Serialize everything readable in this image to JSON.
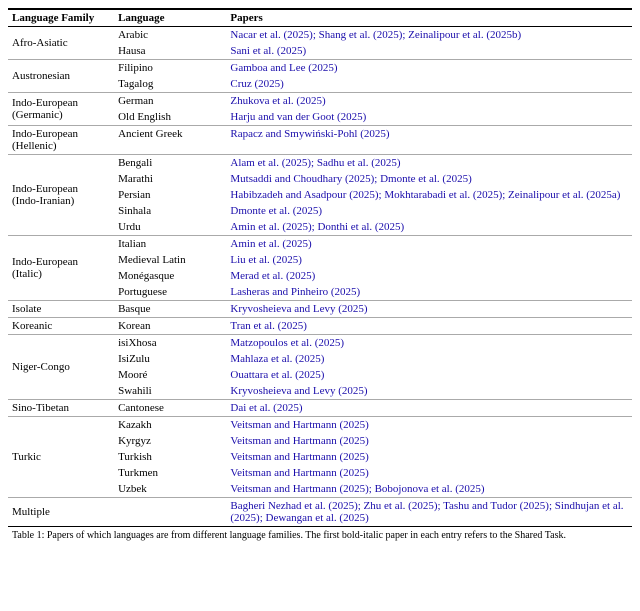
{
  "table": {
    "columns": [
      "Language Family",
      "Language",
      "Papers"
    ],
    "groups": [
      {
        "family": "Afro-Asiatic",
        "rows": [
          {
            "lang": "Arabic",
            "papers": "Nacar et al. (2025); Shang et al. (2025); Zeinalipour et al. (2025b)",
            "blue": true
          },
          {
            "lang": "Hausa",
            "papers": "Sani et al. (2025)",
            "blue": true
          }
        ]
      },
      {
        "family": "Austronesian",
        "rows": [
          {
            "lang": "Filipino",
            "papers": "Gamboa and Lee (2025)",
            "blue": true
          },
          {
            "lang": "Tagalog",
            "papers": "Cruz (2025)",
            "blue": true
          }
        ]
      },
      {
        "family": "Indo-European (Germanic)",
        "rows": [
          {
            "lang": "German",
            "papers": "Zhukova et al. (2025)",
            "blue": true
          },
          {
            "lang": "Old English",
            "papers": "Harju and van der Goot (2025)",
            "blue": true
          }
        ]
      },
      {
        "family": "Indo-European (Hellenic)",
        "rows": [
          {
            "lang": "Ancient Greek",
            "papers": "Rapacz and Smywiński-Pohl (2025)",
            "blue": true
          }
        ]
      },
      {
        "family": "Indo-European (Indo-Iranian)",
        "rows": [
          {
            "lang": "Bengali",
            "papers": "Alam et al. (2025); Sadhu et al. (2025)",
            "blue": true
          },
          {
            "lang": "Marathi",
            "papers": "Mutsaddi and Choudhary (2025); Dmonte et al. (2025)",
            "blue": true
          },
          {
            "lang": "Persian",
            "papers": "Habibzadeh and Asadpour (2025); Mokhtarabadi et al. (2025); Zeinalipour et al. (2025a)",
            "blue": true
          },
          {
            "lang": "Sinhala",
            "papers": "Dmonte et al. (2025)",
            "blue": true
          },
          {
            "lang": "Urdu",
            "papers": "Amin et al. (2025); Donthi et al. (2025)",
            "blue": true
          }
        ]
      },
      {
        "family": "Indo-European (Italic)",
        "rows": [
          {
            "lang": "Italian",
            "papers": "Amin et al. (2025)",
            "blue": true
          },
          {
            "lang": "Medieval Latin",
            "papers": "Liu et al. (2025)",
            "blue": true
          },
          {
            "lang": "Monégasque",
            "papers": "Merad et al. (2025)",
            "blue": true
          },
          {
            "lang": "Portuguese",
            "papers": "Lasheras and Pinheiro (2025)",
            "blue": true
          }
        ]
      },
      {
        "family": "Isolate",
        "rows": [
          {
            "lang": "Basque",
            "papers": "Kryvosheieva and Levy (2025)",
            "blue": true
          }
        ]
      },
      {
        "family": "Koreanic",
        "rows": [
          {
            "lang": "Korean",
            "papers": "Tran et al. (2025)",
            "blue": true
          }
        ]
      },
      {
        "family": "Niger-Congo",
        "rows": [
          {
            "lang": "isiXhosa",
            "papers": "Matzopoulos et al. (2025)",
            "blue": true
          },
          {
            "lang": "IsiZulu",
            "papers": "Mahlaza et al. (2025)",
            "blue": true
          },
          {
            "lang": "Mooré",
            "papers": "Ouattara et al. (2025)",
            "blue": true
          },
          {
            "lang": "Swahili",
            "papers": "Kryvosheieva and Levy (2025)",
            "blue": true
          }
        ]
      },
      {
        "family": "Sino-Tibetan",
        "rows": [
          {
            "lang": "Cantonese",
            "papers": "Dai et al. (2025)",
            "blue": true
          }
        ]
      },
      {
        "family": "Turkic",
        "rows": [
          {
            "lang": "Kazakh",
            "papers": "Veitsman and Hartmann (2025)",
            "blue": true
          },
          {
            "lang": "Kyrgyz",
            "papers": "Veitsman and Hartmann (2025)",
            "blue": true
          },
          {
            "lang": "Turkish",
            "papers": "Veitsman and Hartmann (2025)",
            "blue": true
          },
          {
            "lang": "Turkmen",
            "papers": "Veitsman and Hartmann (2025)",
            "blue": true
          },
          {
            "lang": "Uzbek",
            "papers": "Veitsman and Hartmann (2025); Bobojonova et al. (2025)",
            "blue": true
          }
        ]
      },
      {
        "family": "Multiple",
        "rows": [
          {
            "lang": "",
            "papers": "Bagheri Nezhad et al. (2025); Zhu et al. (2025); Tashu and Tudor (2025); Sindhujan et al. (2025); Dewangan et al. (2025)",
            "blue": true
          }
        ]
      }
    ],
    "caption": "Table 1: Papers of which languages are from different language families. The first bold-italic paper in each entry refers to the Shared Task."
  }
}
